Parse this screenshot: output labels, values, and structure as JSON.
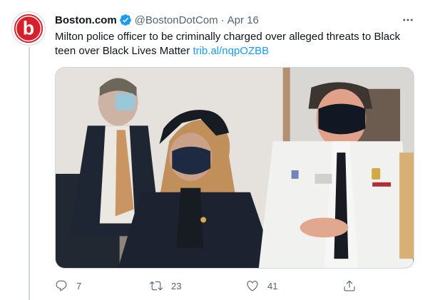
{
  "tweet": {
    "display_name": "Boston.com",
    "handle": "@BostonDotCom",
    "separator": "·",
    "date": "Apr 16",
    "text": "Milton police officer to be criminally charged over alleged threats to Black teen over Black Lives Matter",
    "link": "trib.al/nqpOZBB",
    "avatar_letter": "b",
    "media_alt": "Photo"
  },
  "actions": {
    "replies": "7",
    "retweets": "23",
    "likes": "41"
  },
  "colors": {
    "brand_red": "#d8202d",
    "link_blue": "#1d9bf0",
    "muted_text": "#536471"
  },
  "icons": [
    "verified-badge-icon",
    "more-icon",
    "reply-icon",
    "retweet-icon",
    "like-icon",
    "share-icon"
  ]
}
